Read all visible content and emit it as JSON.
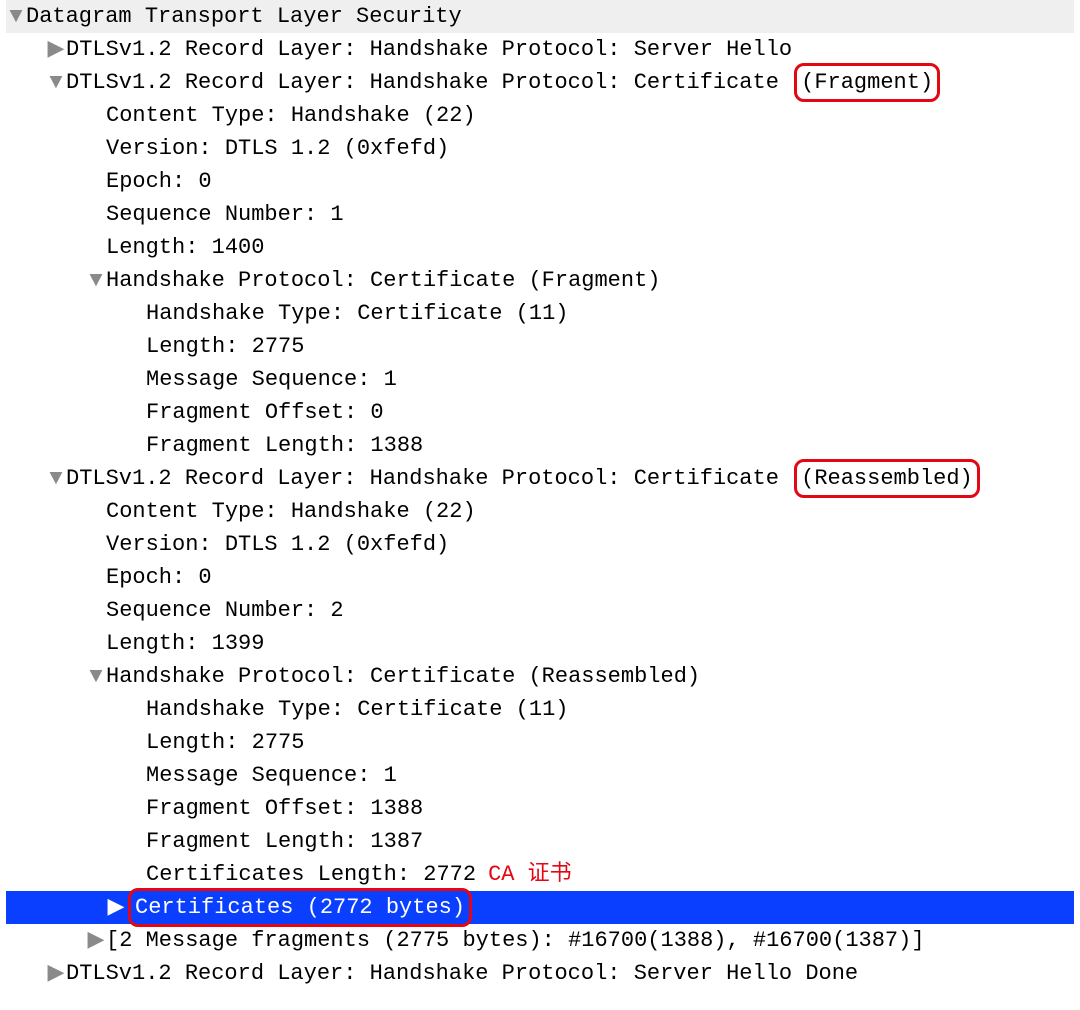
{
  "icons": {
    "open": "▼",
    "closed": "▶"
  },
  "rows": [
    {
      "indent": 0,
      "disc": "open",
      "name": "dtls-root",
      "interact": true,
      "cls": "header",
      "text": "Datagram Transport Layer Security"
    },
    {
      "indent": 40,
      "disc": "closed",
      "name": "rec-server-hello",
      "interact": true,
      "text": "DTLSv1.2 Record Layer: Handshake Protocol: Server Hello"
    },
    {
      "indent": 40,
      "disc": "open",
      "name": "rec-certificate-fragment",
      "interact": true,
      "text": "DTLSv1.2 Record Layer: Handshake Protocol: Certificate ",
      "box": "(Fragment)"
    },
    {
      "indent": 80,
      "disc": "",
      "name": "frag-content-type",
      "interact": false,
      "text": "Content Type: Handshake (22)"
    },
    {
      "indent": 80,
      "disc": "",
      "name": "frag-version",
      "interact": false,
      "text": "Version: DTLS 1.2 (0xfefd)"
    },
    {
      "indent": 80,
      "disc": "",
      "name": "frag-epoch",
      "interact": false,
      "text": "Epoch: 0"
    },
    {
      "indent": 80,
      "disc": "",
      "name": "frag-sequence-number",
      "interact": false,
      "text": "Sequence Number: 1"
    },
    {
      "indent": 80,
      "disc": "",
      "name": "frag-length",
      "interact": false,
      "text": "Length: 1400"
    },
    {
      "indent": 80,
      "disc": "open",
      "name": "frag-handshake-protocol",
      "interact": true,
      "text": "Handshake Protocol: Certificate (Fragment)"
    },
    {
      "indent": 120,
      "disc": "",
      "name": "frag-handshake-type",
      "interact": false,
      "text": "Handshake Type: Certificate (11)"
    },
    {
      "indent": 120,
      "disc": "",
      "name": "frag-handshake-length",
      "interact": false,
      "text": "Length: 2775"
    },
    {
      "indent": 120,
      "disc": "",
      "name": "frag-message-sequence",
      "interact": false,
      "text": "Message Sequence: 1"
    },
    {
      "indent": 120,
      "disc": "",
      "name": "frag-fragment-offset",
      "interact": false,
      "text": "Fragment Offset: 0"
    },
    {
      "indent": 120,
      "disc": "",
      "name": "frag-fragment-length",
      "interact": false,
      "text": "Fragment Length: 1388"
    },
    {
      "indent": 40,
      "disc": "open",
      "name": "rec-certificate-reassembled",
      "interact": true,
      "text": "DTLSv1.2 Record Layer: Handshake Protocol: Certificate ",
      "box": "(Reassembled)"
    },
    {
      "indent": 80,
      "disc": "",
      "name": "reasm-content-type",
      "interact": false,
      "text": "Content Type: Handshake (22)"
    },
    {
      "indent": 80,
      "disc": "",
      "name": "reasm-version",
      "interact": false,
      "text": "Version: DTLS 1.2 (0xfefd)"
    },
    {
      "indent": 80,
      "disc": "",
      "name": "reasm-epoch",
      "interact": false,
      "text": "Epoch: 0"
    },
    {
      "indent": 80,
      "disc": "",
      "name": "reasm-sequence-number",
      "interact": false,
      "text": "Sequence Number: 2"
    },
    {
      "indent": 80,
      "disc": "",
      "name": "reasm-length",
      "interact": false,
      "text": "Length: 1399"
    },
    {
      "indent": 80,
      "disc": "open",
      "name": "reasm-handshake-protocol",
      "interact": true,
      "text": "Handshake Protocol: Certificate (Reassembled)"
    },
    {
      "indent": 120,
      "disc": "",
      "name": "reasm-handshake-type",
      "interact": false,
      "text": "Handshake Type: Certificate (11)"
    },
    {
      "indent": 120,
      "disc": "",
      "name": "reasm-handshake-length",
      "interact": false,
      "text": "Length: 2775"
    },
    {
      "indent": 120,
      "disc": "",
      "name": "reasm-message-sequence",
      "interact": false,
      "text": "Message Sequence: 1"
    },
    {
      "indent": 120,
      "disc": "",
      "name": "reasm-fragment-offset",
      "interact": false,
      "text": "Fragment Offset: 1388"
    },
    {
      "indent": 120,
      "disc": "",
      "name": "reasm-fragment-length",
      "interact": false,
      "text": "Fragment Length: 1387"
    },
    {
      "indent": 120,
      "disc": "",
      "name": "reasm-certificates-length",
      "interact": false,
      "text": "Certificates Length: 2772",
      "note": "CA 证书"
    },
    {
      "indent": 100,
      "disc": "closed",
      "name": "certificates-node",
      "interact": true,
      "cls": "selected",
      "box": "Certificates (2772 bytes)"
    },
    {
      "indent": 80,
      "disc": "closed",
      "name": "message-fragments",
      "interact": true,
      "text": "[2 Message fragments (2775 bytes): #16700(1388), #16700(1387)]"
    },
    {
      "indent": 40,
      "disc": "closed",
      "name": "rec-server-hello-done",
      "interact": true,
      "text": "DTLSv1.2 Record Layer: Handshake Protocol: Server Hello Done"
    }
  ]
}
